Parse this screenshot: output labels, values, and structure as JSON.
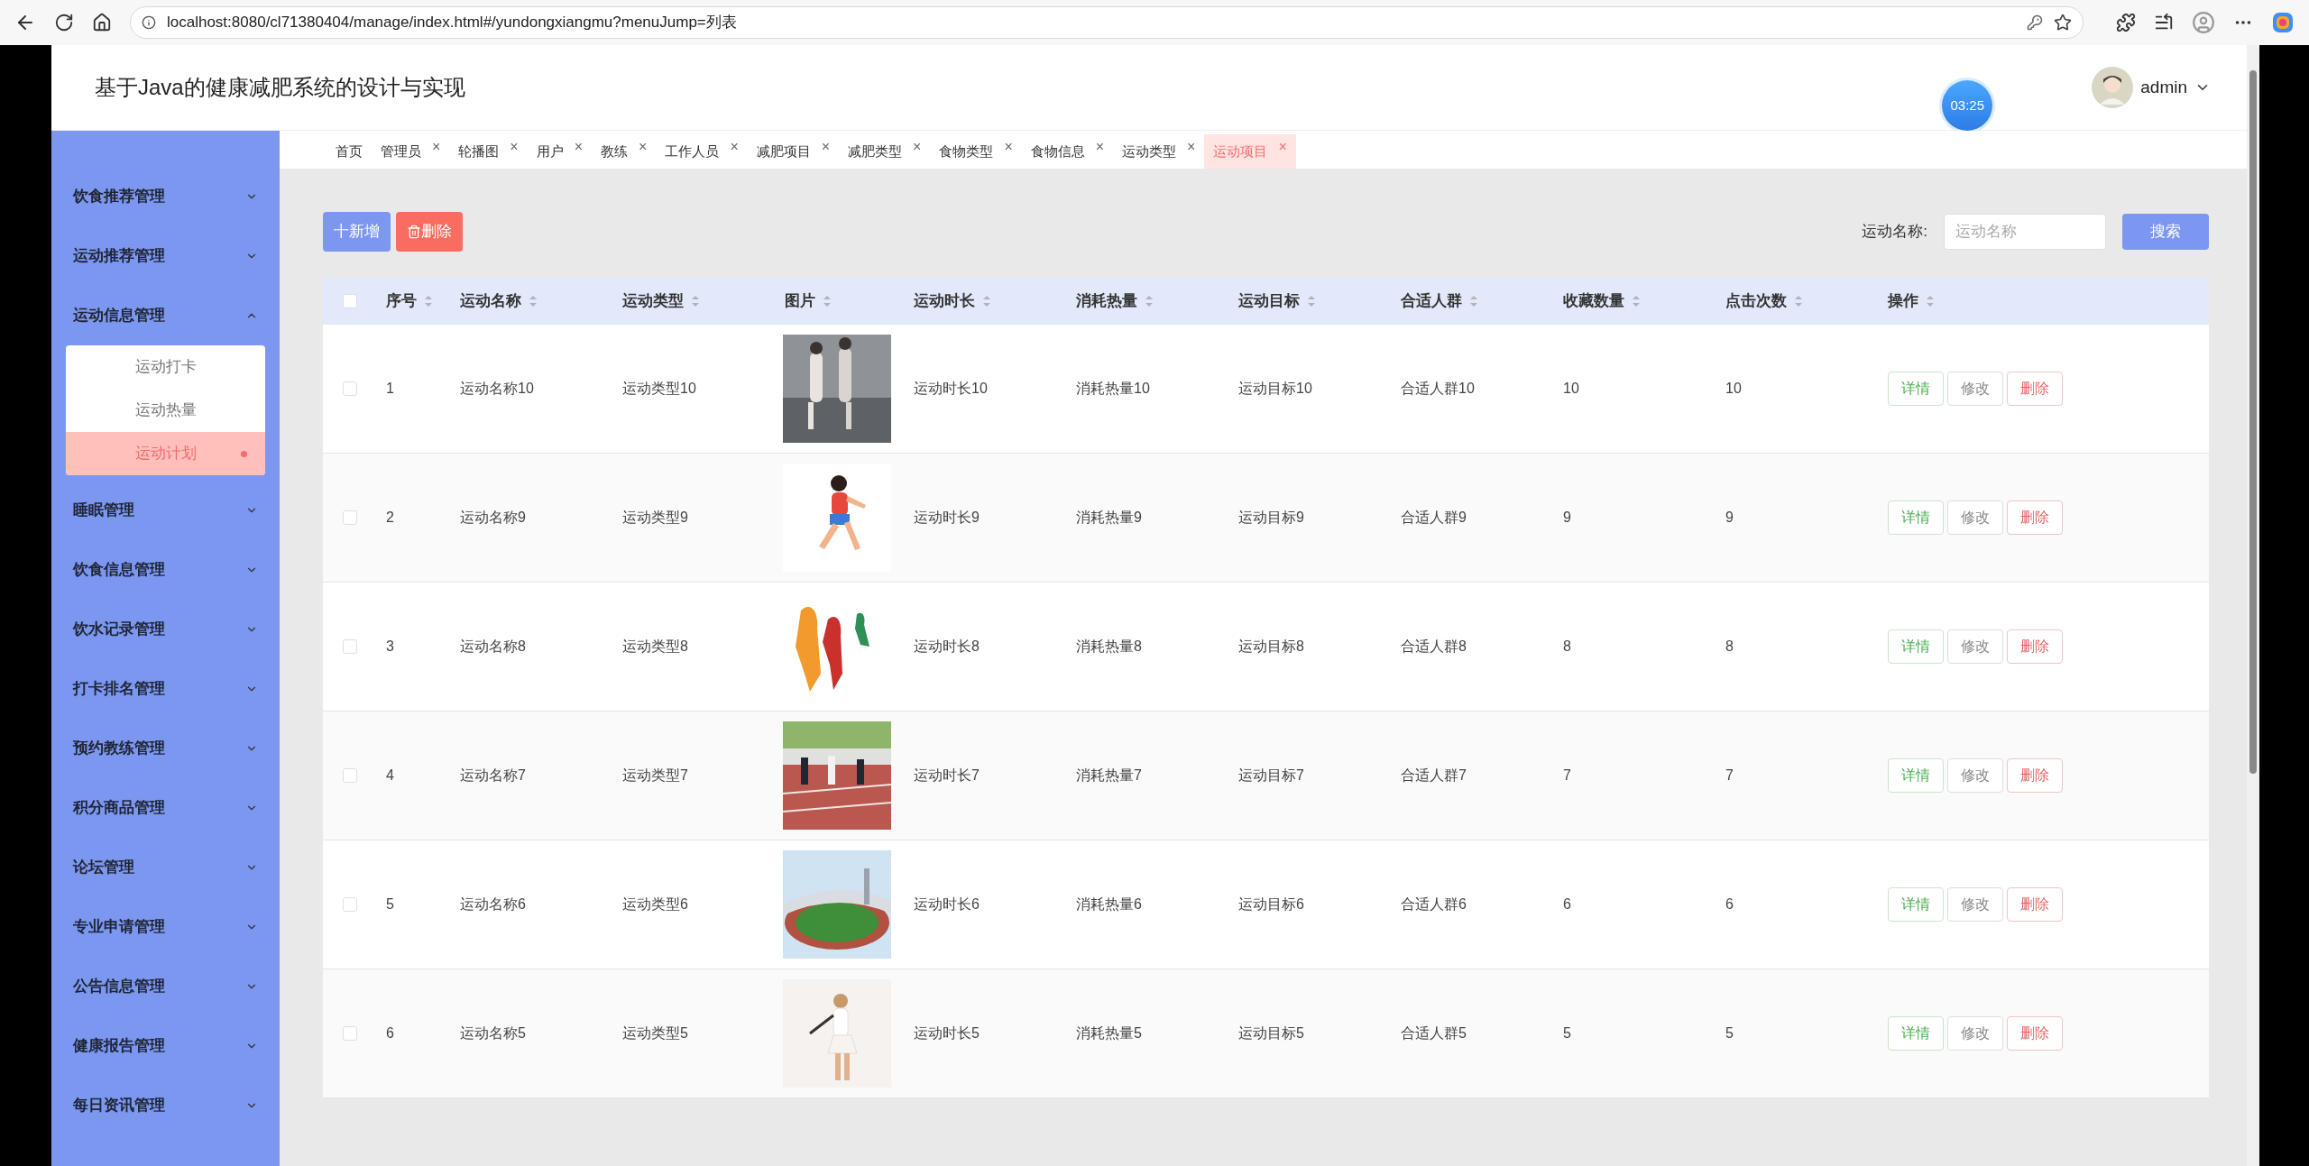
{
  "browser": {
    "url": "localhost:8080/cl71380404/manage/index.html#/yundongxiangmu?menuJump=列表"
  },
  "header": {
    "title": "基于Java的健康减肥系统的设计与实现",
    "timer": "03:25",
    "user": "admin"
  },
  "sidebar": {
    "items": [
      {
        "label": "饮食推荐管理",
        "expanded": false
      },
      {
        "label": "运动推荐管理",
        "expanded": false
      },
      {
        "label": "运动信息管理",
        "expanded": true,
        "children": [
          {
            "label": "运动打卡",
            "selected": false
          },
          {
            "label": "运动热量",
            "selected": false
          },
          {
            "label": "运动计划",
            "selected": true
          }
        ]
      },
      {
        "label": "睡眠管理",
        "expanded": false
      },
      {
        "label": "饮食信息管理",
        "expanded": false
      },
      {
        "label": "饮水记录管理",
        "expanded": false
      },
      {
        "label": "打卡排名管理",
        "expanded": false
      },
      {
        "label": "预约教练管理",
        "expanded": false
      },
      {
        "label": "积分商品管理",
        "expanded": false
      },
      {
        "label": "论坛管理",
        "expanded": false
      },
      {
        "label": "专业申请管理",
        "expanded": false
      },
      {
        "label": "公告信息管理",
        "expanded": false
      },
      {
        "label": "健康报告管理",
        "expanded": false
      },
      {
        "label": "每日资讯管理",
        "expanded": false
      }
    ]
  },
  "tabs": [
    {
      "label": "首页",
      "closable": false,
      "selected": false
    },
    {
      "label": "管理员",
      "closable": true,
      "selected": false
    },
    {
      "label": "轮播图",
      "closable": true,
      "selected": false
    },
    {
      "label": "用户",
      "closable": true,
      "selected": false
    },
    {
      "label": "教练",
      "closable": true,
      "selected": false
    },
    {
      "label": "工作人员",
      "closable": true,
      "selected": false
    },
    {
      "label": "减肥项目",
      "closable": true,
      "selected": false
    },
    {
      "label": "减肥类型",
      "closable": true,
      "selected": false
    },
    {
      "label": "食物类型",
      "closable": true,
      "selected": false
    },
    {
      "label": "食物信息",
      "closable": true,
      "selected": false
    },
    {
      "label": "运动类型",
      "closable": true,
      "selected": false
    },
    {
      "label": "运动项目",
      "closable": true,
      "selected": true
    }
  ],
  "close_glyph": "×",
  "toolbar": {
    "add": "十新增",
    "delete": "删除",
    "search_label": "运动名称:",
    "search_placeholder": "运动名称",
    "search_button": "搜索"
  },
  "table": {
    "select_all": {
      "checked": false
    },
    "columns": [
      "序号",
      "运动名称",
      "运动类型",
      "图片",
      "运动时长",
      "消耗热量",
      "运动目标",
      "合适人群",
      "收藏数量",
      "点击次数",
      "操作"
    ],
    "rows": [
      {
        "checked": false,
        "cells": [
          "1",
          "运动名称10",
          "运动类型10",
          {
            "kind": "picture"
          },
          "运动时长10",
          "消耗热量10",
          "运动目标10",
          "合适人群10",
          "10",
          "10"
        ],
        "actions": [
          {
            "kind": "detail",
            "label": "详情"
          },
          {
            "kind": "edit",
            "label": "修改"
          },
          {
            "kind": "delete",
            "label": "删除"
          }
        ]
      },
      {
        "checked": false,
        "cells": [
          "2",
          "运动名称9",
          "运动类型9",
          {
            "kind": "picture"
          },
          "运动时长9",
          "消耗热量9",
          "运动目标9",
          "合适人群9",
          "9",
          "9"
        ],
        "actions": [
          {
            "kind": "detail",
            "label": "详情"
          },
          {
            "kind": "edit",
            "label": "修改"
          },
          {
            "kind": "delete",
            "label": "删除"
          }
        ]
      },
      {
        "checked": false,
        "cells": [
          "3",
          "运动名称8",
          "运动类型8",
          {
            "kind": "picture"
          },
          "运动时长8",
          "消耗热量8",
          "运动目标8",
          "合适人群8",
          "8",
          "8"
        ],
        "actions": [
          {
            "kind": "detail",
            "label": "详情"
          },
          {
            "kind": "edit",
            "label": "修改"
          },
          {
            "kind": "delete",
            "label": "删除"
          }
        ]
      },
      {
        "checked": false,
        "cells": [
          "4",
          "运动名称7",
          "运动类型7",
          {
            "kind": "picture"
          },
          "运动时长7",
          "消耗热量7",
          "运动目标7",
          "合适人群7",
          "7",
          "7"
        ],
        "actions": [
          {
            "kind": "detail",
            "label": "详情"
          },
          {
            "kind": "edit",
            "label": "修改"
          },
          {
            "kind": "delete",
            "label": "删除"
          }
        ]
      },
      {
        "checked": false,
        "cells": [
          "5",
          "运动名称6",
          "运动类型6",
          {
            "kind": "picture"
          },
          "运动时长6",
          "消耗热量6",
          "运动目标6",
          "合适人群6",
          "6",
          "6"
        ],
        "actions": [
          {
            "kind": "detail",
            "label": "详情"
          },
          {
            "kind": "edit",
            "label": "修改"
          },
          {
            "kind": "delete",
            "label": "删除"
          }
        ]
      },
      {
        "checked": false,
        "cells": [
          "6",
          "运动名称5",
          "运动类型5",
          {
            "kind": "picture"
          },
          "运动时长5",
          "消耗热量5",
          "运动目标5",
          "合适人群5",
          "5",
          "5"
        ],
        "actions": [
          {
            "kind": "detail",
            "label": "详情"
          },
          {
            "kind": "edit",
            "label": "修改"
          },
          {
            "kind": "delete",
            "label": "删除"
          }
        ]
      }
    ]
  }
}
